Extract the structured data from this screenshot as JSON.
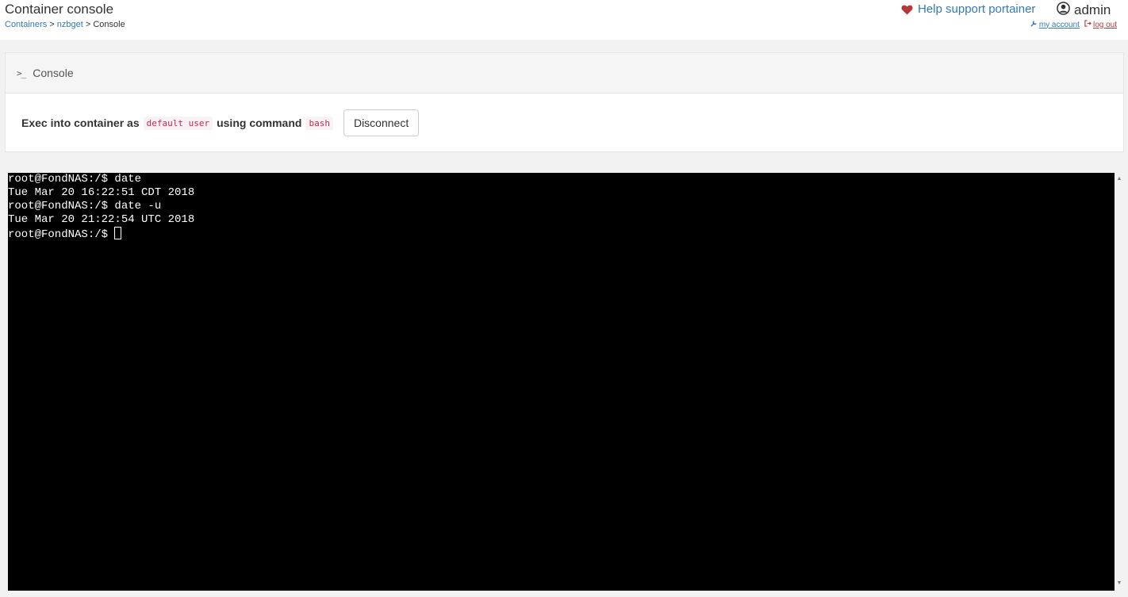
{
  "header": {
    "title": "Container console",
    "breadcrumb": [
      {
        "label": "Containers",
        "link": true
      },
      {
        "label": "nzbget",
        "link": true
      },
      {
        "label": "Console",
        "link": false
      }
    ],
    "breadcrumb_separator": ">",
    "support_label": "Help support portainer",
    "user_name": "admin",
    "my_account_label": "my account",
    "logout_label": "log out"
  },
  "widget": {
    "title": "Console",
    "exec_prefix": "Exec into container as",
    "user_value": "default user",
    "command_mid": "using command",
    "command_value": "bash",
    "disconnect_label": "Disconnect"
  },
  "terminal": {
    "lines": [
      "root@FondNAS:/$ date",
      "Tue Mar 20 16:22:51 CDT 2018",
      "root@FondNAS:/$ date -u",
      "Tue Mar 20 21:22:54 UTC 2018",
      "root@FondNAS:/$ "
    ]
  },
  "colors": {
    "link": "#337ab7",
    "heart": "#b33a3a",
    "code_text": "#c7254e",
    "terminal_bg": "#000000",
    "terminal_fg": "#ffffff"
  },
  "icons": {
    "support": "heart-icon",
    "user": "user-circle-icon",
    "account": "wrench-icon",
    "logout": "sign-out-icon",
    "console": "terminal-icon"
  }
}
